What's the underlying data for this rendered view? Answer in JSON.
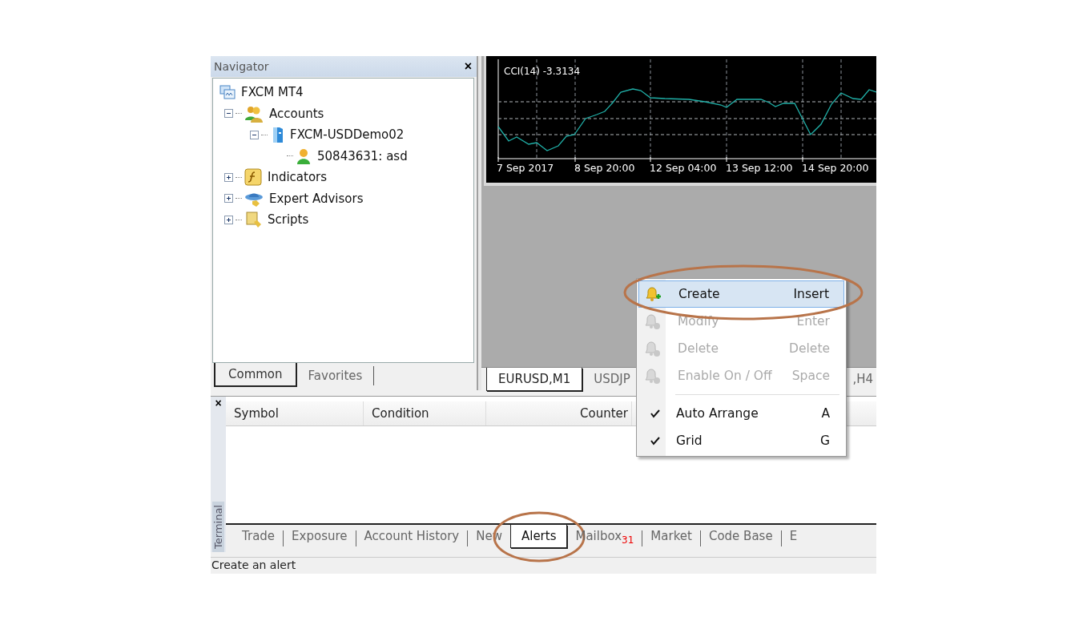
{
  "navigator": {
    "title": "Navigator",
    "close": "×",
    "tree": [
      {
        "label": "FXCM MT4",
        "kind": "terminal",
        "children": [
          {
            "label": "Accounts",
            "kind": "accounts",
            "expanded": true,
            "children": [
              {
                "label": "FXCM-USDDemo02",
                "kind": "server",
                "expanded": true,
                "children": [
                  {
                    "label": "50843631: asd",
                    "kind": "user"
                  }
                ]
              }
            ]
          },
          {
            "label": "Indicators",
            "kind": "indicators",
            "expanded": false
          },
          {
            "label": "Expert Advisors",
            "kind": "experts",
            "expanded": false
          },
          {
            "label": "Scripts",
            "kind": "scripts",
            "expanded": false
          }
        ]
      }
    ],
    "tabs": [
      {
        "label": "Common",
        "selected": true
      },
      {
        "label": "Favorites",
        "selected": false
      }
    ]
  },
  "chart": {
    "indicator": "CCI(14) -3.3134",
    "time_labels": [
      "7 Sep 2017",
      "8 Sep 20:00",
      "12 Sep 04:00",
      "13 Sep 12:00",
      "14 Sep 20:00"
    ]
  },
  "chart_tabs": [
    {
      "label": "EURUSD,M1",
      "selected": true
    },
    {
      "label": "USDJP",
      "selected": false
    },
    {
      "label": ",H4",
      "selected": false
    }
  ],
  "context_menu": [
    {
      "kind": "item",
      "label": "Create",
      "shortcut": "Insert",
      "disabled": false,
      "highlighted": true,
      "circled": true
    },
    {
      "kind": "item",
      "label": "Modify",
      "shortcut": "Enter",
      "disabled": true,
      "highlighted": false,
      "circled": false
    },
    {
      "kind": "item",
      "label": "Delete",
      "shortcut": "Delete",
      "disabled": true,
      "highlighted": false,
      "circled": false
    },
    {
      "kind": "item",
      "label": "Enable On / Off",
      "shortcut": "Space",
      "disabled": true,
      "highlighted": false,
      "circled": false
    },
    {
      "kind": "separator"
    },
    {
      "kind": "check",
      "label": "Auto Arrange",
      "shortcut": "A",
      "checked": true
    },
    {
      "kind": "check",
      "label": "Grid",
      "shortcut": "G",
      "checked": true
    }
  ],
  "terminal": {
    "title": "Terminal",
    "close": "×",
    "columns": [
      "Symbol",
      "Condition",
      "Counter"
    ],
    "tabs": [
      {
        "label": "Trade",
        "selected": false,
        "circled": false
      },
      {
        "label": "Exposure",
        "selected": false,
        "circled": false
      },
      {
        "label": "Account History",
        "selected": false,
        "circled": false
      },
      {
        "label": "New",
        "selected": false,
        "circled": false
      },
      {
        "label": "Alerts",
        "selected": true,
        "circled": true
      },
      {
        "label": "Mailbox",
        "badge": "31",
        "selected": false,
        "circled": false
      },
      {
        "label": "Market",
        "selected": false,
        "circled": false
      },
      {
        "label": "Code Base",
        "selected": false,
        "circled": false
      },
      {
        "label": "E",
        "selected": false,
        "circled": false
      }
    ]
  },
  "status_bar": "Create an alert"
}
